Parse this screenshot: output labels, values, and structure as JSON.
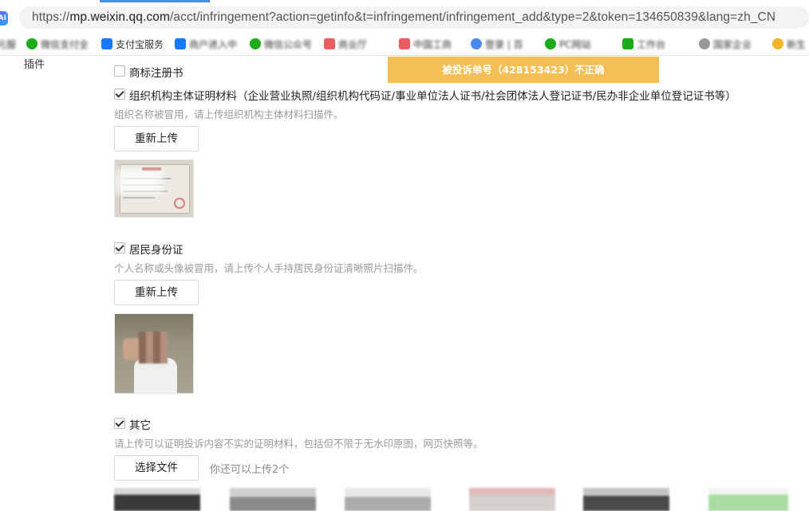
{
  "browser": {
    "app_icon": "AI",
    "url_prefix": "https://",
    "url_host": "mp.weixin.qq.com",
    "url_path": "/acct/infringement?action=getinfo&t=infringement/infringement_add&type=2&token=134650839&lang=zh_CN",
    "bookmarks": [
      {
        "label": "元服",
        "icon_color": "#ffffff"
      },
      {
        "label": "微信支付全",
        "icon_color": "#1aad19"
      },
      {
        "label": "支付宝服务",
        "icon_color": "#1677ff"
      },
      {
        "label": "商户进入中",
        "icon_color": "#1677ff"
      },
      {
        "label": "微信公众号",
        "icon_color": "#1aad19"
      },
      {
        "label": "商业厅",
        "icon_color": "#e85d5d"
      },
      {
        "label": "中国工商",
        "icon_color": "#e85d5d"
      },
      {
        "label": "登录 | 百",
        "icon_color": "#4a8af4"
      },
      {
        "label": "PC网站",
        "icon_color": "#1aad19"
      },
      {
        "label": "工作台",
        "icon_color": "#1aad19"
      },
      {
        "label": "国家企业",
        "icon_color": "#999999"
      },
      {
        "label": "新生",
        "icon_color": "#f0b429"
      }
    ]
  },
  "form": {
    "left_label": "插件",
    "warning": "被投诉单号（428153423）不正确",
    "trademark": {
      "label": "商标注册书",
      "checked": false
    },
    "org": {
      "label": "组织机构主体证明材料（企业营业执照/组织机构代码证/事业单位法人证书/社会团体法人登记证书/民办非企业单位登记证书等）",
      "checked": true,
      "hint": "组织名称被冒用，请上传组织机构主体材料扫描件。",
      "button": "重新上传"
    },
    "id_card": {
      "label": "居民身份证",
      "checked": true,
      "hint": "个人名称或头像被冒用，请上传个人手持居民身份证清晰照片扫描件。",
      "button": "重新上传"
    },
    "other": {
      "label": "其它",
      "checked": true,
      "hint": "请上传可以证明投诉内容不实的证明材料，包括但不限于无水印原图，网页快照等。",
      "button": "选择文件",
      "remaining": "你还可以上传2个"
    }
  },
  "colors": {
    "warning_bg": "#f5bf55",
    "hint_text": "#9a9a9a",
    "accent": "#4a8af4"
  }
}
